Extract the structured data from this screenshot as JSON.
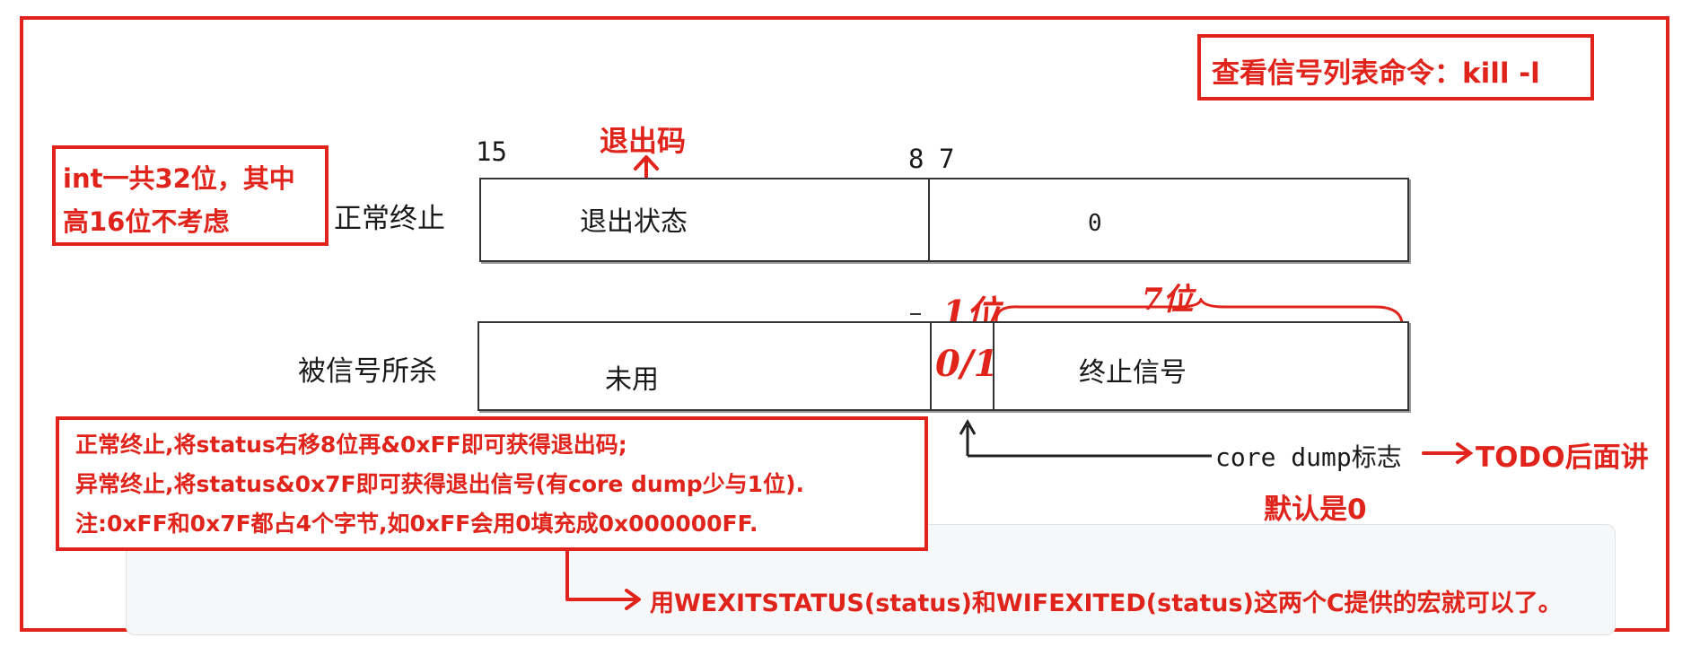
{
  "header_note": "查看信号列表命令：kill -l",
  "left_note": {
    "line1": "int一共32位，其中",
    "line2": "高16位不考虑"
  },
  "bit_labels": {
    "b15": "15",
    "b8": "8",
    "b7": "7"
  },
  "annotation_exit_code": "退出码",
  "row_normal": {
    "label": "正常终止",
    "high": "退出状态",
    "low": "0"
  },
  "row_signal": {
    "label": "被信号所杀",
    "high": "未用",
    "flag": "0/1",
    "low": "终止信号"
  },
  "hand_notes": {
    "one_bit": "1位",
    "seven_bits": "7位"
  },
  "core_dump": {
    "label": "core dump标志",
    "todo": "TODO后面讲",
    "default": "默认是0"
  },
  "explain": {
    "line1": "正常终止,将status右移8位再&0xFF即可获得退出码;",
    "line2": "异常终止,将status&0x7F即可获得退出信号(有core dump少与1位).",
    "line3": "注:0xFF和0x7F都占4个字节,如0xFF会用0填充成0x000000FF."
  },
  "macro_note": "用WEXITSTATUS(status)和WIFEXITED(status)这两个C提供的宏就可以了。",
  "colors": {
    "accent": "#e0241b",
    "text": "#1a1a1a",
    "panel": "#f6f7f8"
  }
}
